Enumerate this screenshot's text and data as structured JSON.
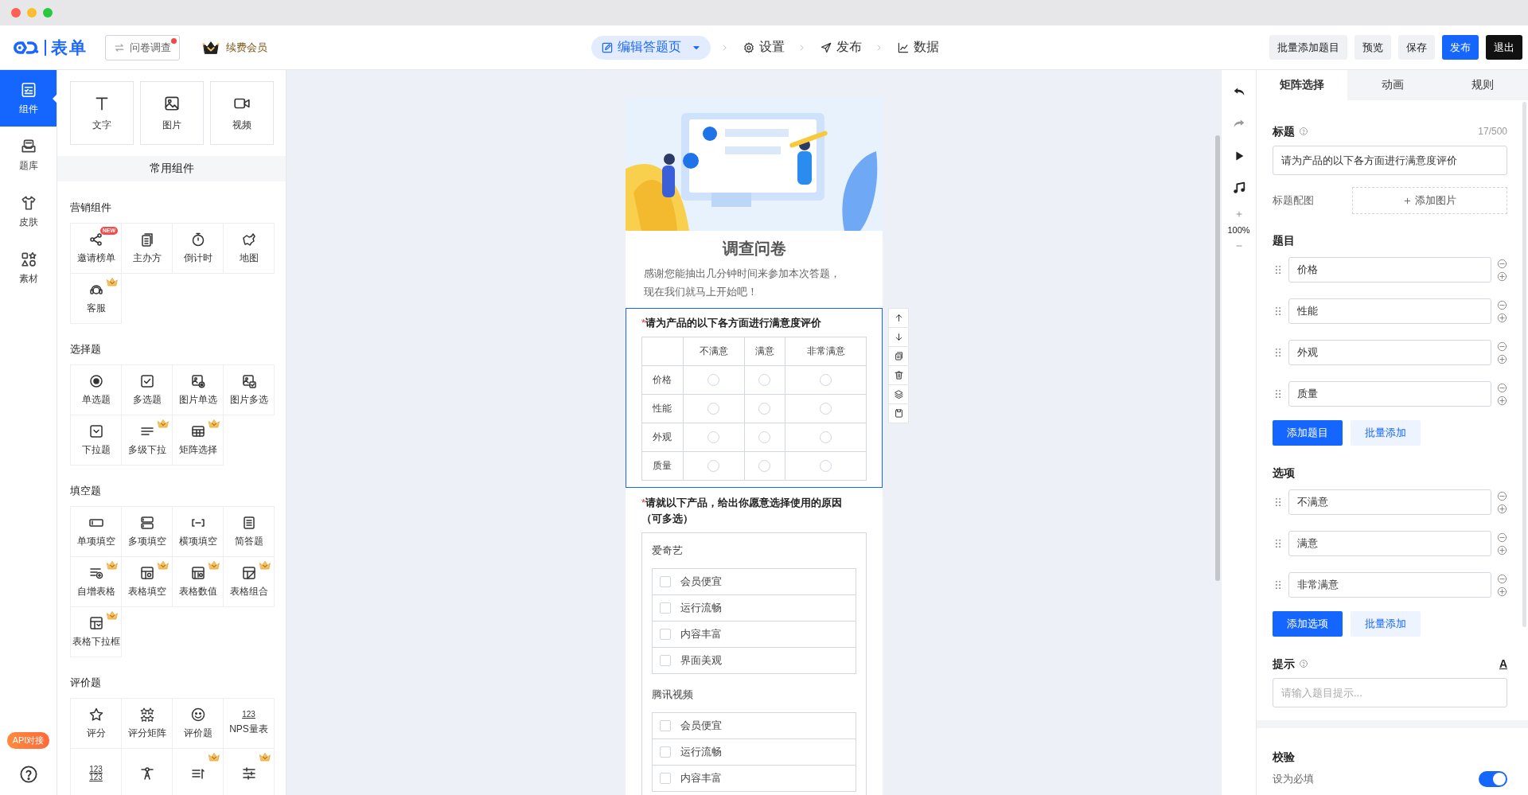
{
  "header": {
    "logo": "表单",
    "mode_switch": {
      "label": "问卷调查",
      "notification": true
    },
    "member_link": "续费会员",
    "steps": [
      {
        "label": "编辑答题页",
        "selected": true,
        "has_menu": true
      },
      {
        "label": "设置",
        "selected": false,
        "has_menu": false
      },
      {
        "label": "发布",
        "selected": false,
        "has_menu": false
      },
      {
        "label": "数据",
        "selected": false,
        "has_menu": false
      }
    ],
    "actions": [
      {
        "label": "批量添加题目",
        "kind": "secondary"
      },
      {
        "label": "预览",
        "kind": "secondary"
      },
      {
        "label": "保存",
        "kind": "secondary"
      },
      {
        "label": "发布",
        "kind": "primary"
      },
      {
        "label": "退出",
        "kind": "dark"
      }
    ]
  },
  "rail": {
    "items": [
      {
        "label": "组件",
        "selected": true
      },
      {
        "label": "题库",
        "selected": false
      },
      {
        "label": "皮肤",
        "selected": false
      },
      {
        "label": "素材",
        "selected": false
      }
    ],
    "api_badge": "API对接"
  },
  "components": {
    "basic": [
      "文字",
      "图片",
      "视频"
    ],
    "common_title": "常用组件",
    "sections": [
      {
        "title": "营销组件",
        "items": [
          {
            "label": "邀请榜单",
            "badge": "NEW",
            "vip": false
          },
          {
            "label": "主办方",
            "vip": false
          },
          {
            "label": "倒计时",
            "vip": false
          },
          {
            "label": "地图",
            "vip": false
          },
          {
            "label": "客服",
            "vip": true
          }
        ]
      },
      {
        "title": "选择题",
        "items": [
          {
            "label": "单选题",
            "vip": false
          },
          {
            "label": "多选题",
            "vip": false
          },
          {
            "label": "图片单选",
            "vip": false
          },
          {
            "label": "图片多选",
            "vip": false
          },
          {
            "label": "下拉题",
            "vip": false
          },
          {
            "label": "多级下拉",
            "vip": true
          },
          {
            "label": "矩阵选择",
            "vip": true
          }
        ]
      },
      {
        "title": "填空题",
        "items": [
          {
            "label": "单项填空",
            "vip": false
          },
          {
            "label": "多项填空",
            "vip": false
          },
          {
            "label": "横项填空",
            "vip": false
          },
          {
            "label": "简答题",
            "vip": false
          },
          {
            "label": "自增表格",
            "vip": true
          },
          {
            "label": "表格填空",
            "vip": true
          },
          {
            "label": "表格数值",
            "vip": true
          },
          {
            "label": "表格组合",
            "vip": true
          },
          {
            "label": "表格下拉框",
            "vip": true
          }
        ]
      },
      {
        "title": "评价题",
        "items": [
          {
            "label": "评分",
            "vip": false
          },
          {
            "label": "评分矩阵",
            "vip": false
          },
          {
            "label": "评价题",
            "vip": false
          },
          {
            "label": "NPS量表",
            "icon_text": [
              "123"
            ],
            "vip": false
          },
          {
            "icon_text": [
              "123",
              "123"
            ],
            "vip": false
          },
          {
            "vip": false
          },
          {
            "vip": true
          },
          {
            "vip": true
          }
        ]
      }
    ]
  },
  "survey": {
    "title": "调查问卷",
    "description": "感谢您能抽出几分钟时间来参加本次答题，现在我们就马上开始吧！",
    "questions": [
      {
        "kind": "matrix",
        "required_mark": "*",
        "selected": true,
        "title": "请为产品的以下各方面进行满意度评价",
        "columns": [
          "不满意",
          "满意",
          "非常满意"
        ],
        "rows": [
          {
            "label": "价格",
            "checked": [
              false,
              false,
              false
            ]
          },
          {
            "label": "性能",
            "checked": [
              false,
              false,
              false
            ]
          },
          {
            "label": "外观",
            "checked": [
              false,
              false,
              false
            ]
          },
          {
            "label": "质量",
            "checked": [
              false,
              false,
              false
            ]
          }
        ]
      },
      {
        "kind": "grouped_checkbox",
        "required_mark": "*",
        "selected": false,
        "title": "请就以下产品，给出你愿意选择使用的原因（可多选）",
        "groups": [
          {
            "name": "爱奇艺",
            "options": [
              {
                "label": "会员便宜",
                "checked": false
              },
              {
                "label": "运行流畅",
                "checked": false
              },
              {
                "label": "内容丰富",
                "checked": false
              },
              {
                "label": "界面美观",
                "checked": false
              }
            ]
          },
          {
            "name": "腾讯视频",
            "options": [
              {
                "label": "会员便宜",
                "checked": false
              },
              {
                "label": "运行流畅",
                "checked": false
              },
              {
                "label": "内容丰富",
                "checked": false
              }
            ]
          }
        ]
      }
    ]
  },
  "tools": {
    "zoom": "100%"
  },
  "props": {
    "tabs": [
      {
        "label": "矩阵选择",
        "selected": true
      },
      {
        "label": "动画",
        "selected": false
      },
      {
        "label": "规则",
        "selected": false
      }
    ],
    "title_label": "标题",
    "title_counter": "17/500",
    "title_value": "请为产品的以下各方面进行满意度评价",
    "image_label": "标题配图",
    "add_image": "添加图片",
    "rows_label": "题目",
    "rows": [
      "价格",
      "性能",
      "外观",
      "质量"
    ],
    "add_row": "添加题目",
    "batch_add_rows": "批量添加",
    "options_label": "选项",
    "options": [
      "不满意",
      "满意",
      "非常满意"
    ],
    "add_option": "添加选项",
    "batch_add_options": "批量添加",
    "hint_label": "提示",
    "hint_format": "A",
    "hint_placeholder": "请输入题目提示...",
    "validation_label": "校验",
    "required_label": "设为必填",
    "required": true
  }
}
